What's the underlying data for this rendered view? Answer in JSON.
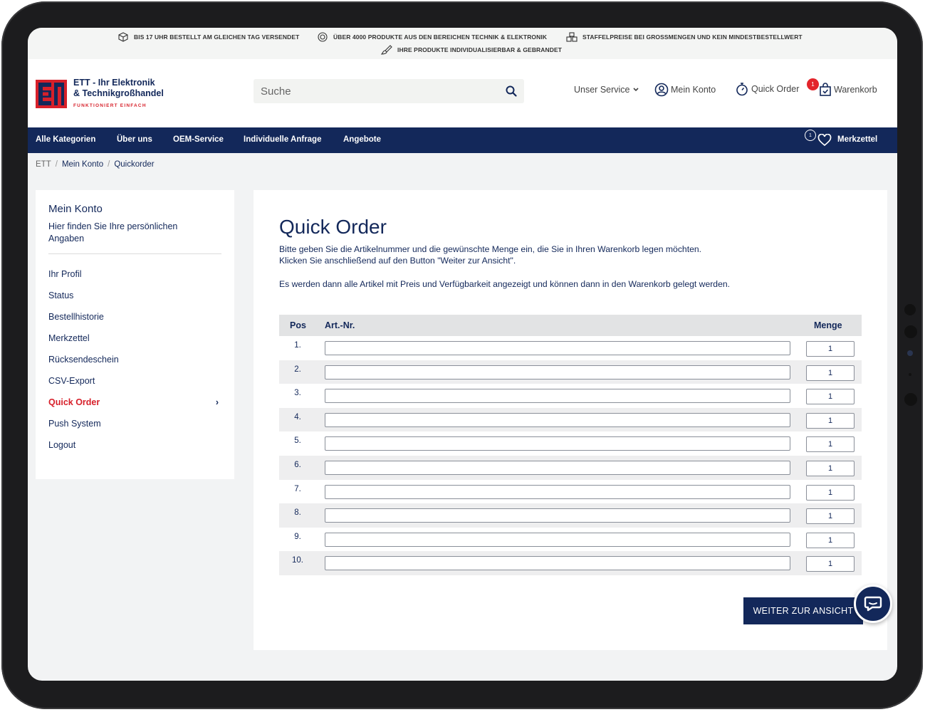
{
  "infobar": {
    "items": [
      "BIS 17 UHR BESTELLT AM GLEICHEN TAG VERSENDET",
      "ÜBER 4000 PRODUKTE AUS DEN BEREICHEN TECHNIK & ELEKTRONIK",
      "STAFFELPREISE BEI GROSSMENGEN UND KEIN MINDESTBESTELLWERT",
      "IHRE PRODUKTE INDIVIDUALISIERBAR & GEBRANDET"
    ]
  },
  "brand": {
    "line1": "ETT - Ihr Elektronik",
    "line2": "& Technikgroßhandel",
    "tagline": "FUNKTIONIERT EINFACH",
    "colors": {
      "navy": "#13285a",
      "red": "#d7202a"
    }
  },
  "search": {
    "placeholder": "Suche"
  },
  "header_nav": {
    "service": "Unser Service",
    "account": "Mein Konto",
    "quick_order": "Quick Order",
    "cart": "Warenkorb",
    "cart_count": "1"
  },
  "main_nav": {
    "items": [
      "Alle Kategorien",
      "Über uns",
      "OEM-Service",
      "Individuelle Anfrage",
      "Angebote"
    ],
    "wishlist": "Merkzettel",
    "wishlist_count": "1"
  },
  "breadcrumb": [
    "ETT",
    "Mein Konto",
    "Quickorder"
  ],
  "sidebar": {
    "title": "Mein Konto",
    "subtitle": "Hier finden Sie Ihre persönlichen Angaben",
    "items": [
      "Ihr Profil",
      "Status",
      "Bestellhistorie",
      "Merkzettel",
      "Rücksendeschein",
      "CSV-Export",
      "Quick Order",
      "Push System",
      "Logout"
    ],
    "active": "Quick Order"
  },
  "quick_order": {
    "title": "Quick Order",
    "intro1": "Bitte geben Sie die Artikelnummer und die gewünschte Menge ein, die Sie in Ihren Warenkorb legen möchten.",
    "intro2": "Klicken Sie anschließend auf den Button \"Weiter zur Ansicht\".",
    "intro3": "Es werden dann alle Artikel mit Preis und Verfügbarkeit angezeigt und können dann in den Warenkorb gelegt werden.",
    "columns": {
      "pos": "Pos",
      "art": "Art.-Nr.",
      "qty": "Menge"
    },
    "rows": [
      {
        "pos": "1.",
        "art": "",
        "qty": "1"
      },
      {
        "pos": "2.",
        "art": "",
        "qty": "1"
      },
      {
        "pos": "3.",
        "art": "",
        "qty": "1"
      },
      {
        "pos": "4.",
        "art": "",
        "qty": "1"
      },
      {
        "pos": "5.",
        "art": "",
        "qty": "1"
      },
      {
        "pos": "6.",
        "art": "",
        "qty": "1"
      },
      {
        "pos": "7.",
        "art": "",
        "qty": "1"
      },
      {
        "pos": "8.",
        "art": "",
        "qty": "1"
      },
      {
        "pos": "9.",
        "art": "",
        "qty": "1"
      },
      {
        "pos": "10.",
        "art": "",
        "qty": "1"
      }
    ],
    "submit": "WEITER ZUR ANSICHT"
  }
}
